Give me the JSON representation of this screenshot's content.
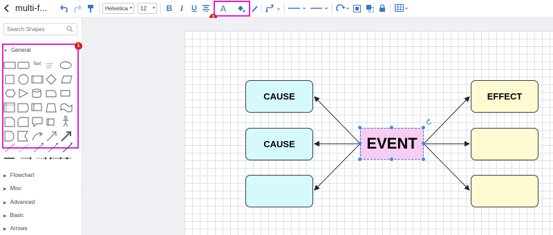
{
  "header": {
    "title": "multi-f...",
    "font_family": "Helvetica",
    "font_size": "12",
    "toolbar_icons": [
      "back-icon",
      "undo-icon",
      "redo-icon",
      "format-painter-icon",
      "bold-icon",
      "italic-icon",
      "underline-icon",
      "align-icon",
      "font-color-icon",
      "fill-color-icon",
      "line-color-icon",
      "connector-style-icon",
      "line-style-icon",
      "arrow-style-icon",
      "arrange-icon",
      "group-icon",
      "ungroup-icon",
      "lock-icon",
      "table-icon"
    ]
  },
  "sidebar": {
    "search_placeholder": "Search Shapes",
    "general_label": "General",
    "text_shape_label": "Text",
    "categories": [
      "Flowchart",
      "Misc",
      "Advanced",
      "Basic",
      "Arrows"
    ],
    "collapse_glyph": "«"
  },
  "annotations": {
    "badge_1": "1",
    "badge_2": "2",
    "highlight_color": "#e01fd6"
  },
  "diagram": {
    "event": "EVENT",
    "causes": [
      "CAUSE",
      "CAUSE",
      ""
    ],
    "effects": [
      "EFFECT",
      "",
      ""
    ],
    "colors": {
      "cause": "#d6f9fc",
      "effect": "#fdfbd2",
      "event": "#f8cdf4",
      "accent": "#3a78c6"
    }
  }
}
